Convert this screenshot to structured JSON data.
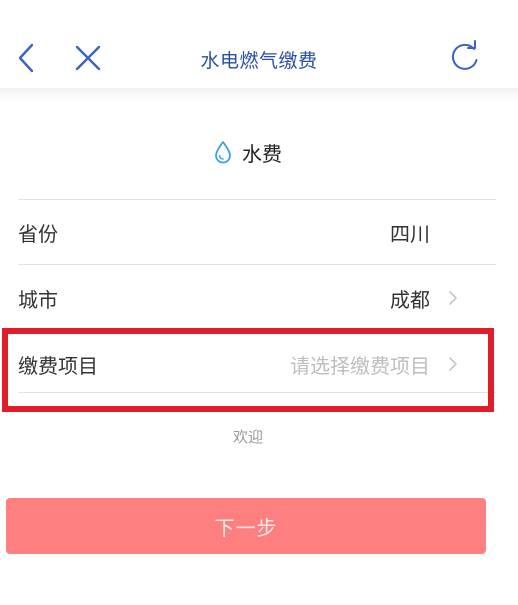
{
  "nav": {
    "title": "水电燃气缴费"
  },
  "bill": {
    "type_label": "水费"
  },
  "form": {
    "rows": [
      {
        "label": "省份",
        "value": "四川"
      },
      {
        "label": "城市",
        "value": "成都"
      },
      {
        "label": "缴费项目",
        "placeholder": "请选择缴费项目"
      }
    ]
  },
  "welcome_text": "欢迎",
  "next_button_label": "下一步",
  "colors": {
    "title_blue": "#2a4fa6",
    "icon_blue": "#3b63c4",
    "drop_blue": "#3aa0e6",
    "button": "#fd7f7f",
    "highlight_red": "#e21d2a"
  },
  "icons": {
    "back": "chevron-left-icon",
    "close": "close-icon",
    "refresh": "refresh-icon",
    "bill": "water-drop-icon",
    "row_arrow": "chevron-right-icon"
  }
}
